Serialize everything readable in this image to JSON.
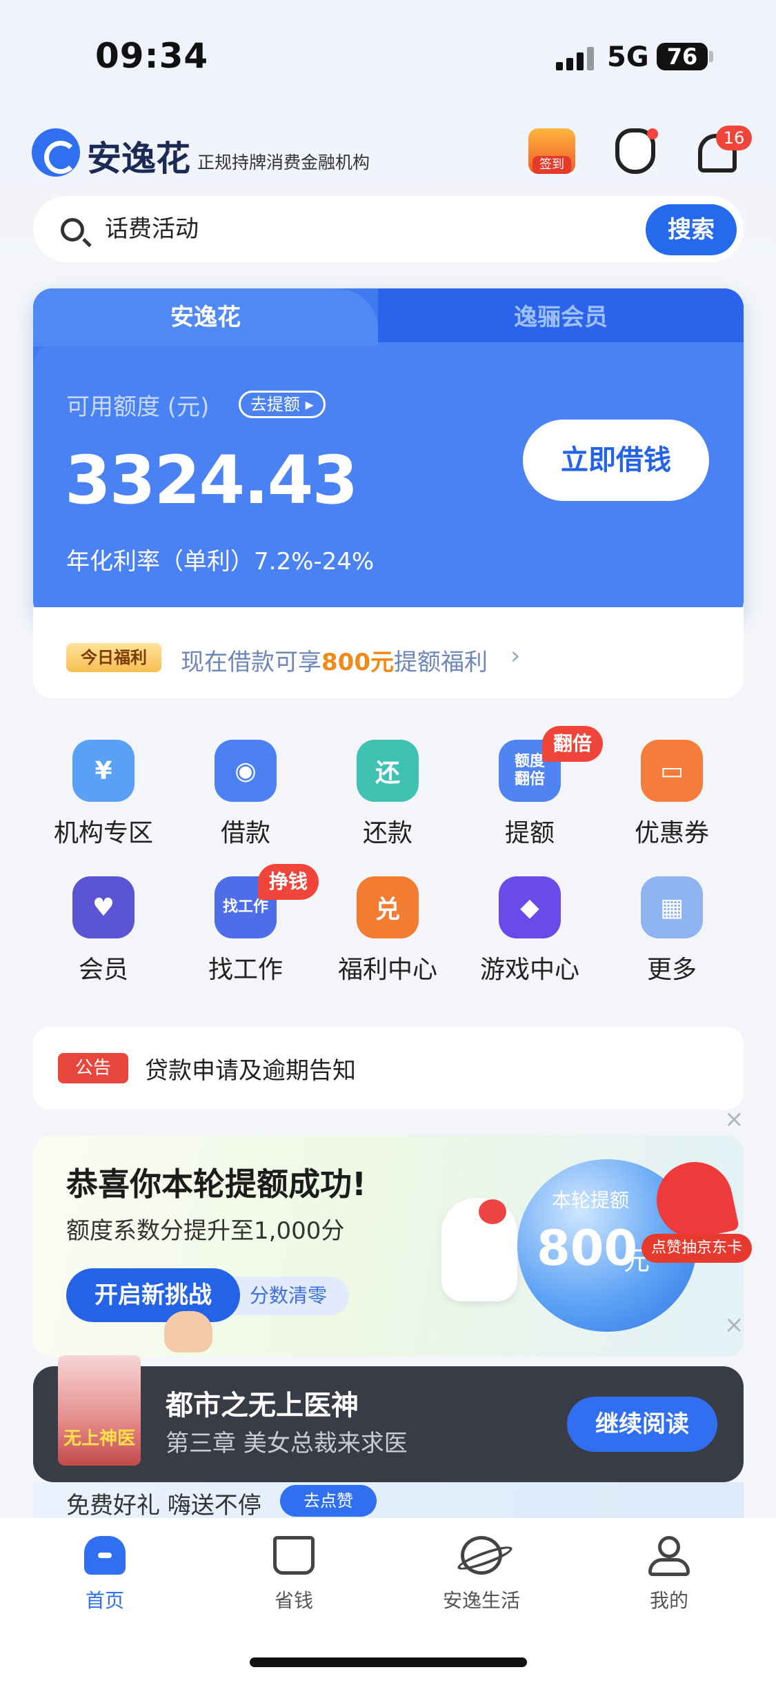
{
  "status": {
    "time": "09:34",
    "network": "5G",
    "battery": "76"
  },
  "header": {
    "brand": "安逸花",
    "brand_sub": "正规持牌消费金融机构",
    "sign_label": "签到",
    "bell_badge": "16"
  },
  "search": {
    "query": "话费活动",
    "button": "搜索"
  },
  "card": {
    "tabs": [
      "安逸花",
      "逸骊会员"
    ],
    "available_label": "可用额度 (元)",
    "raise_label": "去提额 ▸",
    "amount": "3324.43",
    "rate": "年化利率（单利）7.2%-24%",
    "borrow_button": "立即借钱"
  },
  "welfare": {
    "tag": "今日福利",
    "text_pre": "现在借款可享",
    "text_highlight": "800元",
    "text_post": "提额福利",
    "arrow": "›"
  },
  "grid": {
    "items": [
      {
        "label": "机构专区",
        "icon": "institution-icon",
        "glyph": "¥",
        "color": "#5aa0f7"
      },
      {
        "label": "借款",
        "icon": "loan-icon",
        "glyph": "◉",
        "color": "#4d80f0"
      },
      {
        "label": "还款",
        "icon": "repay-icon",
        "glyph": "还",
        "color": "#3fc2b1"
      },
      {
        "label": "提额",
        "icon": "raise-limit-icon",
        "glyph": "额度\n翻倍",
        "color": "#4f84f2"
      },
      {
        "label": "优惠券",
        "icon": "coupon-icon",
        "glyph": "▭",
        "color": "#f47d3b"
      },
      {
        "label": "会员",
        "icon": "member-icon",
        "glyph": "♥",
        "color": "#5b55d6"
      },
      {
        "label": "找工作",
        "icon": "job-icon",
        "glyph": "找工作",
        "color": "#4d6ee8"
      },
      {
        "label": "福利中心",
        "icon": "welfare-center-icon",
        "glyph": "兑",
        "color": "#f27d32"
      },
      {
        "label": "游戏中心",
        "icon": "game-icon",
        "glyph": "◆",
        "color": "#6a4bea"
      },
      {
        "label": "更多",
        "icon": "more-icon",
        "glyph": "▦",
        "color": "#8fb4f0"
      }
    ],
    "badge_raise": "翻倍",
    "badge_job": "挣钱"
  },
  "notice": {
    "tag": "公告",
    "text": "贷款申请及逾期告知"
  },
  "promo": {
    "title": "恭喜你本轮提额成功!",
    "subtitle": "额度系数分提升至1,000分",
    "challenge_button": "开启新挑战",
    "reset_label": "分数清零",
    "orb_label": "本轮提额",
    "orb_value": "800",
    "orb_unit": "元",
    "jd_tag": "点赞抽京东卡",
    "close": "×"
  },
  "reading": {
    "book_title": "都市之无上医神",
    "chapter": "第三章 美女总裁来求医",
    "cover_text": "无上神医",
    "continue_button": "继续阅读"
  },
  "gift": {
    "text": "免费好礼 嗨送不停",
    "like_button": "去点赞"
  },
  "tabbar": {
    "items": [
      {
        "label": "首页",
        "icon": "home-icon"
      },
      {
        "label": "省钱",
        "icon": "save-money-icon"
      },
      {
        "label": "安逸生活",
        "icon": "planet-icon"
      },
      {
        "label": "我的",
        "icon": "profile-icon"
      }
    ]
  }
}
